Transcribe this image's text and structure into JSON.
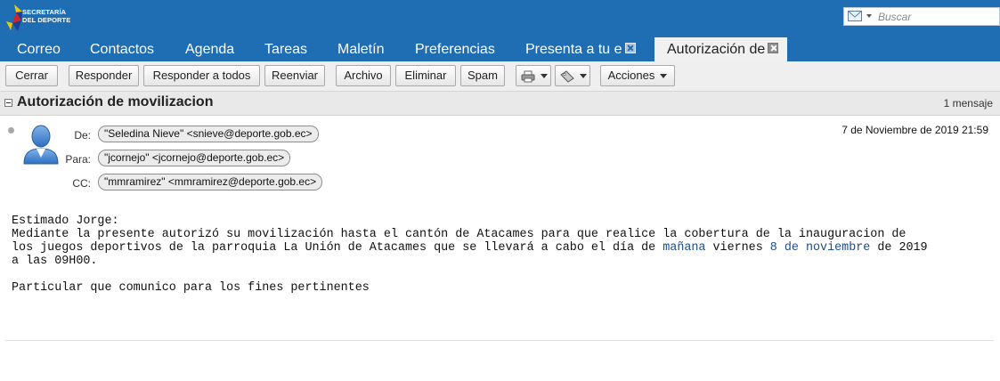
{
  "brand": {
    "line1": "SECRETARÍA",
    "line2": "DEL DEPORTE",
    "colors": [
      "#f2c500",
      "#1b3f94",
      "#d3232b"
    ]
  },
  "search": {
    "placeholder": "Buscar",
    "icon": "envelope-icon"
  },
  "tabs": [
    {
      "label": "Correo"
    },
    {
      "label": "Contactos"
    },
    {
      "label": "Agenda"
    },
    {
      "label": "Tareas"
    },
    {
      "label": "Maletín"
    },
    {
      "label": "Preferencias"
    },
    {
      "label": "Presenta a tu e",
      "closable": true
    },
    {
      "label": "Autorización de",
      "closable": true,
      "active": true
    }
  ],
  "toolbar": {
    "close": "Cerrar",
    "reply": "Responder",
    "reply_all": "Responder a todos",
    "forward": "Reenviar",
    "archive": "Archivo",
    "delete": "Eliminar",
    "spam": "Spam",
    "print_icon": "print-icon",
    "tag_icon": "tag-icon",
    "actions": "Acciones"
  },
  "message": {
    "subject": "Autorización de movilizacion",
    "count": "1 mensaje",
    "from_label": "De:",
    "from": "\"Seledina Nieve\" <snieve@deporte.gob.ec>",
    "to_label": "Para:",
    "to": "\"jcornejo\" <jcornejo@deporte.gob.ec>",
    "cc_label": "CC:",
    "cc": "\"mmramirez\" <mmramirez@deporte.gob.ec>",
    "date": "7 de Noviembre de 2019 21:59",
    "body": {
      "greeting": "Estimado Jorge:",
      "line1": "Mediante la presente autorizó su movilización hasta el cantón de Atacames para que realice la cobertura de la inauguracion de",
      "line2_a": "los juegos deportivos de la parroquia La Unión de Atacames que se llevará a cabo el día de ",
      "line2_link1": "mañana",
      "line2_b": " viernes ",
      "line2_link2": "8 de noviembre",
      "line2_c": " de 2019",
      "line3": "a las 09H00.",
      "closing": "Particular que comunico para los fines pertinentes"
    }
  },
  "colors": {
    "header_bg": "#1f6db3",
    "link": "#1c4c8c",
    "toolbar_bg": "#efefef"
  }
}
